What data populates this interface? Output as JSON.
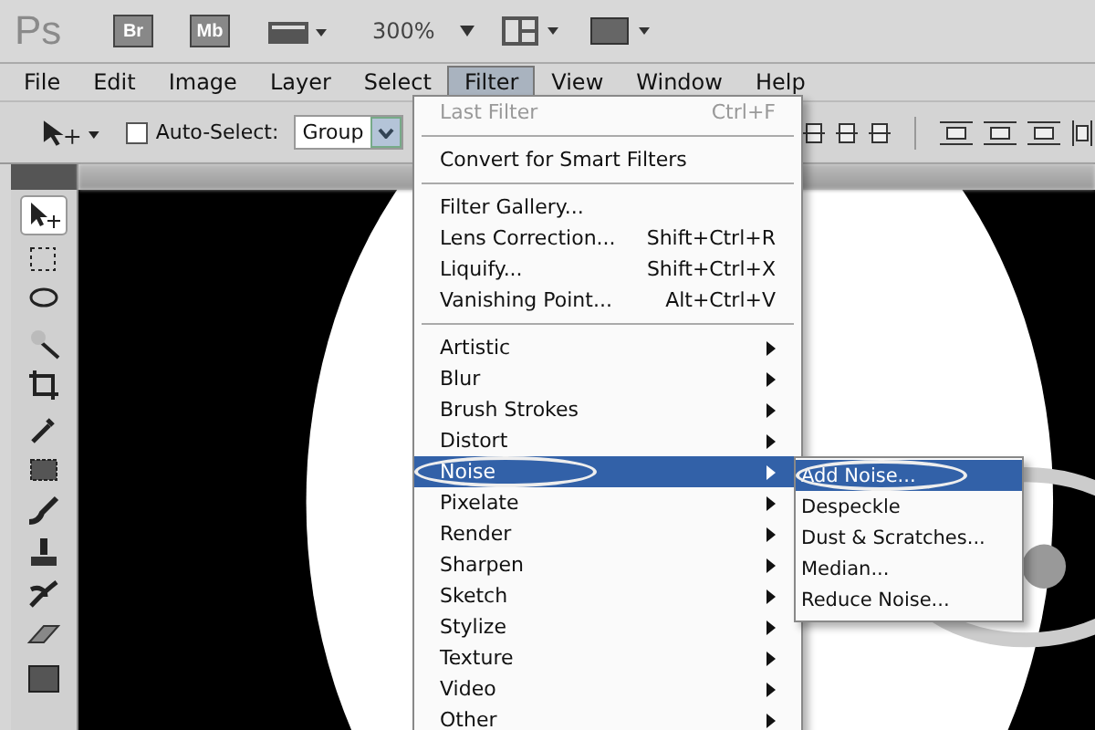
{
  "app_bar": {
    "logo": "Ps",
    "buttons": [
      "Br",
      "Mb"
    ],
    "zoom": "300%"
  },
  "menu_bar": [
    {
      "label": "File",
      "selected": false
    },
    {
      "label": "Edit",
      "selected": false
    },
    {
      "label": "Image",
      "selected": false
    },
    {
      "label": "Layer",
      "selected": false
    },
    {
      "label": "Select",
      "selected": false
    },
    {
      "label": "Filter",
      "selected": true
    },
    {
      "label": "View",
      "selected": false
    },
    {
      "label": "Window",
      "selected": false
    },
    {
      "label": "Help",
      "selected": false
    }
  ],
  "options_bar": {
    "auto_select": {
      "label": "Auto-Select:",
      "checked": false
    },
    "target": "Group"
  },
  "filter_menu": [
    {
      "kind": "item",
      "label": "Last Filter",
      "shortcut": "Ctrl+F",
      "disabled": true
    },
    {
      "kind": "separator"
    },
    {
      "kind": "item",
      "label": "Convert for Smart Filters",
      "disabled": false
    },
    {
      "kind": "separator"
    },
    {
      "kind": "item",
      "label": "Filter Gallery...",
      "disabled": false
    },
    {
      "kind": "item",
      "label": "Lens Correction...",
      "shortcut": "Shift+Ctrl+R",
      "disabled": false
    },
    {
      "kind": "item",
      "label": "Liquify...",
      "shortcut": "Shift+Ctrl+X",
      "disabled": false
    },
    {
      "kind": "item",
      "label": "Vanishing Point...",
      "shortcut": "Alt+Ctrl+V",
      "disabled": false
    },
    {
      "kind": "separator"
    },
    {
      "kind": "submenu",
      "label": "Artistic",
      "selected": false,
      "circled": false
    },
    {
      "kind": "submenu",
      "label": "Blur",
      "selected": false,
      "circled": false
    },
    {
      "kind": "submenu",
      "label": "Brush Strokes",
      "selected": false,
      "circled": false
    },
    {
      "kind": "submenu",
      "label": "Distort",
      "selected": false,
      "circled": false
    },
    {
      "kind": "submenu",
      "label": "Noise",
      "selected": true,
      "circled": true
    },
    {
      "kind": "submenu",
      "label": "Pixelate",
      "selected": false,
      "circled": false
    },
    {
      "kind": "submenu",
      "label": "Render",
      "selected": false,
      "circled": false
    },
    {
      "kind": "submenu",
      "label": "Sharpen",
      "selected": false,
      "circled": false
    },
    {
      "kind": "submenu",
      "label": "Sketch",
      "selected": false,
      "circled": false
    },
    {
      "kind": "submenu",
      "label": "Stylize",
      "selected": false,
      "circled": false
    },
    {
      "kind": "submenu",
      "label": "Texture",
      "selected": false,
      "circled": false
    },
    {
      "kind": "submenu",
      "label": "Video",
      "selected": false,
      "circled": false
    },
    {
      "kind": "submenu",
      "label": "Other",
      "selected": false,
      "circled": false
    }
  ],
  "noise_submenu": [
    {
      "label": "Add Noise...",
      "selected": true,
      "circled": true
    },
    {
      "label": "Despeckle",
      "selected": false,
      "circled": false
    },
    {
      "label": "Dust & Scratches...",
      "selected": false,
      "circled": false
    },
    {
      "label": "Median...",
      "selected": false,
      "circled": false
    },
    {
      "label": "Reduce Noise...",
      "selected": false,
      "circled": false
    }
  ]
}
